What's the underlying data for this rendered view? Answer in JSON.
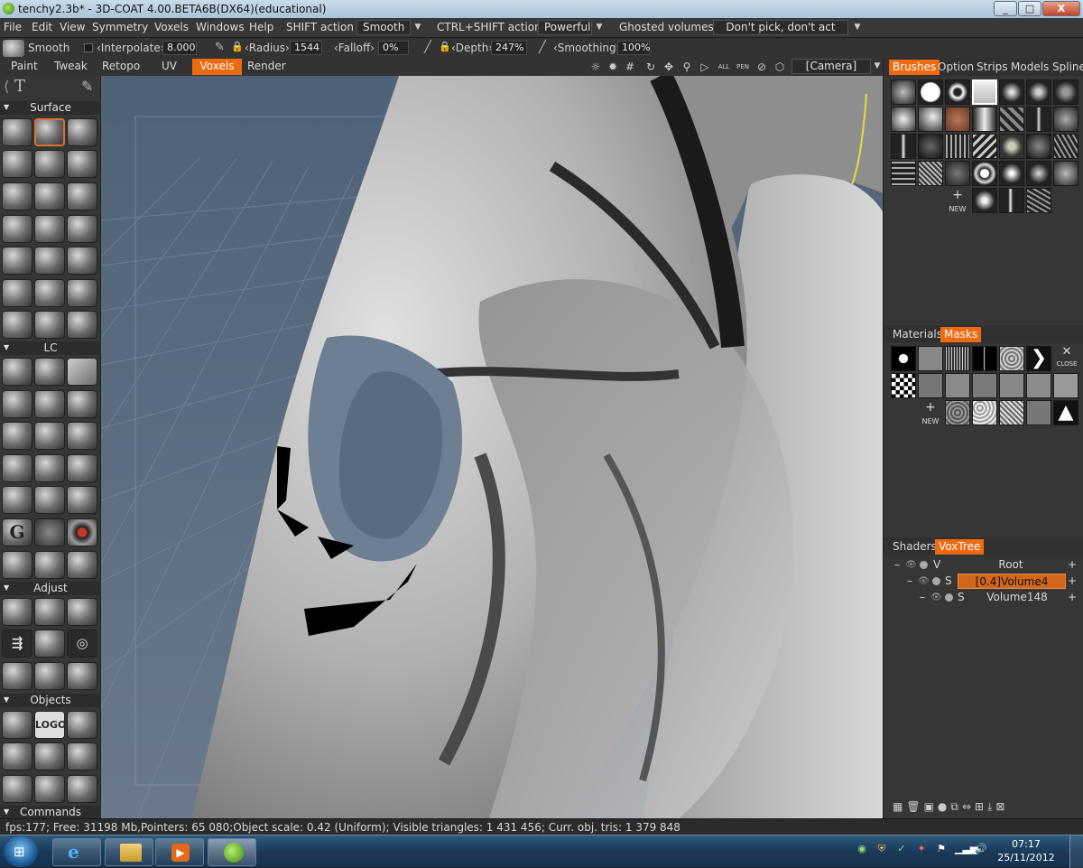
{
  "window": {
    "title": "tenchy2.3b* - 3D-COAT 4.00.BETA6B(DX64)(educational)",
    "minimize": "_",
    "maximize": "□",
    "close": "X"
  },
  "menu": {
    "items": [
      "File",
      "Edit",
      "View",
      "Symmetry",
      "Voxels",
      "Windows",
      "Help"
    ],
    "shift_action_label": "SHIFT action",
    "shift_action_value": "Smooth",
    "ctrl_shift_action_label": "CTRL+SHIFT action",
    "ctrl_shift_action_value": "Powerful",
    "ghosted_label": "Ghosted volumes:",
    "ghosted_value": "Don't pick, don't act"
  },
  "brushbar": {
    "tool_name": "Smooth",
    "interpolate_label": "‹Interpolate›",
    "interpolate_value": "8.000",
    "radius_label": "‹Radius›",
    "radius_value": "1544",
    "falloff_label": "‹Falloff›",
    "falloff_value": "0%",
    "depth_label": "‹Depth›",
    "depth_value": "247%",
    "smoothing_label": "‹Smoothing›",
    "smoothing_value": "100%"
  },
  "mode_tabs": [
    "Paint",
    "Tweak",
    "Retopo",
    "UV",
    "Voxels",
    "Render"
  ],
  "active_mode": "Voxels",
  "camera_dropdown": "[Camera]",
  "left_panel": {
    "sections": {
      "surface": "Surface",
      "lc": "LC",
      "adjust": "Adjust",
      "objects": "Objects",
      "commands": "Commands"
    },
    "logo_tool": "LOGO"
  },
  "right_panel": {
    "brush_tabs": [
      "Brushes",
      "Option",
      "Strips",
      "Models",
      "Spline"
    ],
    "active_brush_tab": "Brushes",
    "new_label": "NEW",
    "mask_tabs": [
      "Materials",
      "Masks"
    ],
    "active_mask_tab": "Masks",
    "close_label": "CLOSE",
    "tree_tabs": [
      "Shaders",
      "VoxTree"
    ],
    "active_tree_tab": "VoxTree",
    "tree": [
      {
        "mode": "V",
        "name": "Root",
        "selected": false
      },
      {
        "mode": "S",
        "name": "[0.4]Volume4",
        "selected": true
      },
      {
        "mode": "S",
        "name": "Volume148",
        "selected": false
      }
    ],
    "plus": "+",
    "minus": "–"
  },
  "status": {
    "text": "fps:177;    Free: 31198 Mb,Pointers: 65 080;Object scale: 0.42 (Uniform); Visible triangles: 1 431 456; Curr. obj. tris: 1 379 848"
  },
  "taskbar": {
    "time": "07:17",
    "date": "25/11/2012"
  },
  "colors": {
    "accent": "#ee6a10",
    "viewport_bg": "#5b6c7f",
    "panel_bg": "#363636"
  }
}
